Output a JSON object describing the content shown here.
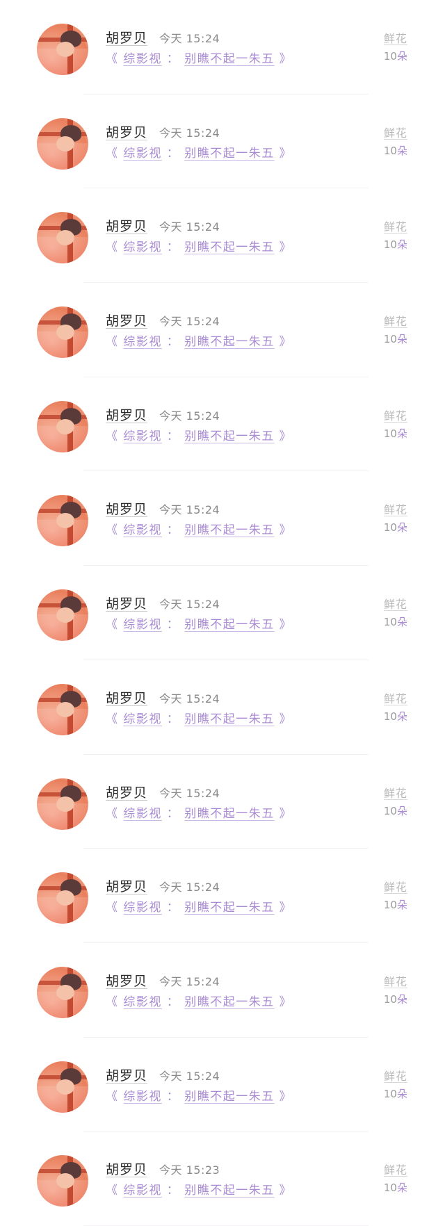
{
  "items": [
    {
      "name": "胡罗贝",
      "day": "今天",
      "time": "15:24",
      "book_prefix": "《 ",
      "book_part1": "综影视",
      "book_sep": " ： ",
      "book_part2": "别瞧不起一朱五",
      "book_suffix": " 》",
      "gift_label": "鲜花",
      "gift_count": "10",
      "gift_unit": "朵"
    },
    {
      "name": "胡罗贝",
      "day": "今天",
      "time": "15:24",
      "book_prefix": "《 ",
      "book_part1": "综影视",
      "book_sep": " ： ",
      "book_part2": "别瞧不起一朱五",
      "book_suffix": " 》",
      "gift_label": "鲜花",
      "gift_count": "10",
      "gift_unit": "朵"
    },
    {
      "name": "胡罗贝",
      "day": "今天",
      "time": "15:24",
      "book_prefix": "《 ",
      "book_part1": "综影视",
      "book_sep": " ： ",
      "book_part2": "别瞧不起一朱五",
      "book_suffix": " 》",
      "gift_label": "鲜花",
      "gift_count": "10",
      "gift_unit": "朵"
    },
    {
      "name": "胡罗贝",
      "day": "今天",
      "time": "15:24",
      "book_prefix": "《 ",
      "book_part1": "综影视",
      "book_sep": " ： ",
      "book_part2": "别瞧不起一朱五",
      "book_suffix": " 》",
      "gift_label": "鲜花",
      "gift_count": "10",
      "gift_unit": "朵"
    },
    {
      "name": "胡罗贝",
      "day": "今天",
      "time": "15:24",
      "book_prefix": "《 ",
      "book_part1": "综影视",
      "book_sep": " ： ",
      "book_part2": "别瞧不起一朱五",
      "book_suffix": " 》",
      "gift_label": "鲜花",
      "gift_count": "10",
      "gift_unit": "朵"
    },
    {
      "name": "胡罗贝",
      "day": "今天",
      "time": "15:24",
      "book_prefix": "《 ",
      "book_part1": "综影视",
      "book_sep": " ： ",
      "book_part2": "别瞧不起一朱五",
      "book_suffix": " 》",
      "gift_label": "鲜花",
      "gift_count": "10",
      "gift_unit": "朵"
    },
    {
      "name": "胡罗贝",
      "day": "今天",
      "time": "15:24",
      "book_prefix": "《 ",
      "book_part1": "综影视",
      "book_sep": " ： ",
      "book_part2": "别瞧不起一朱五",
      "book_suffix": " 》",
      "gift_label": "鲜花",
      "gift_count": "10",
      "gift_unit": "朵"
    },
    {
      "name": "胡罗贝",
      "day": "今天",
      "time": "15:24",
      "book_prefix": "《 ",
      "book_part1": "综影视",
      "book_sep": " ： ",
      "book_part2": "别瞧不起一朱五",
      "book_suffix": " 》",
      "gift_label": "鲜花",
      "gift_count": "10",
      "gift_unit": "朵"
    },
    {
      "name": "胡罗贝",
      "day": "今天",
      "time": "15:24",
      "book_prefix": "《 ",
      "book_part1": "综影视",
      "book_sep": " ： ",
      "book_part2": "别瞧不起一朱五",
      "book_suffix": " 》",
      "gift_label": "鲜花",
      "gift_count": "10",
      "gift_unit": "朵"
    },
    {
      "name": "胡罗贝",
      "day": "今天",
      "time": "15:24",
      "book_prefix": "《 ",
      "book_part1": "综影视",
      "book_sep": " ： ",
      "book_part2": "别瞧不起一朱五",
      "book_suffix": " 》",
      "gift_label": "鲜花",
      "gift_count": "10",
      "gift_unit": "朵"
    },
    {
      "name": "胡罗贝",
      "day": "今天",
      "time": "15:24",
      "book_prefix": "《 ",
      "book_part1": "综影视",
      "book_sep": " ： ",
      "book_part2": "别瞧不起一朱五",
      "book_suffix": " 》",
      "gift_label": "鲜花",
      "gift_count": "10",
      "gift_unit": "朵"
    },
    {
      "name": "胡罗贝",
      "day": "今天",
      "time": "15:24",
      "book_prefix": "《 ",
      "book_part1": "综影视",
      "book_sep": " ： ",
      "book_part2": "别瞧不起一朱五",
      "book_suffix": " 》",
      "gift_label": "鲜花",
      "gift_count": "10",
      "gift_unit": "朵"
    },
    {
      "name": "胡罗贝",
      "day": "今天",
      "time": "15:23",
      "book_prefix": "《 ",
      "book_part1": "综影视",
      "book_sep": " ： ",
      "book_part2": "别瞧不起一朱五",
      "book_suffix": " 》",
      "gift_label": "鲜花",
      "gift_count": "10",
      "gift_unit": "朵"
    }
  ]
}
